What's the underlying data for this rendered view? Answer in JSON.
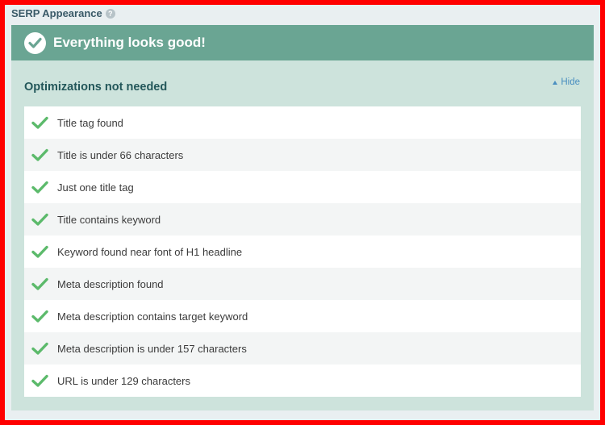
{
  "section": {
    "title": "SERP Appearance",
    "help_icon": "?"
  },
  "banner": {
    "icon": "check-circle-icon",
    "text": "Everything looks good!"
  },
  "subsection": {
    "title": "Optimizations not needed",
    "hide_label": "Hide"
  },
  "items": [
    {
      "label": "Title tag found",
      "status": "pass"
    },
    {
      "label": "Title is under 66 characters",
      "status": "pass"
    },
    {
      "label": "Just one title tag",
      "status": "pass"
    },
    {
      "label": "Title contains keyword",
      "status": "pass"
    },
    {
      "label": "Keyword found near font of H1 headline",
      "status": "pass"
    },
    {
      "label": "Meta description found",
      "status": "pass"
    },
    {
      "label": "Meta description contains target keyword",
      "status": "pass"
    },
    {
      "label": "Meta description is under 157 characters",
      "status": "pass"
    },
    {
      "label": "URL is under 129 characters",
      "status": "pass"
    }
  ],
  "colors": {
    "frame_border": "#ff0000",
    "banner": "#6aa593",
    "panel": "#cde3dc",
    "check": "#5cba6b",
    "link": "#4a8fc0"
  }
}
